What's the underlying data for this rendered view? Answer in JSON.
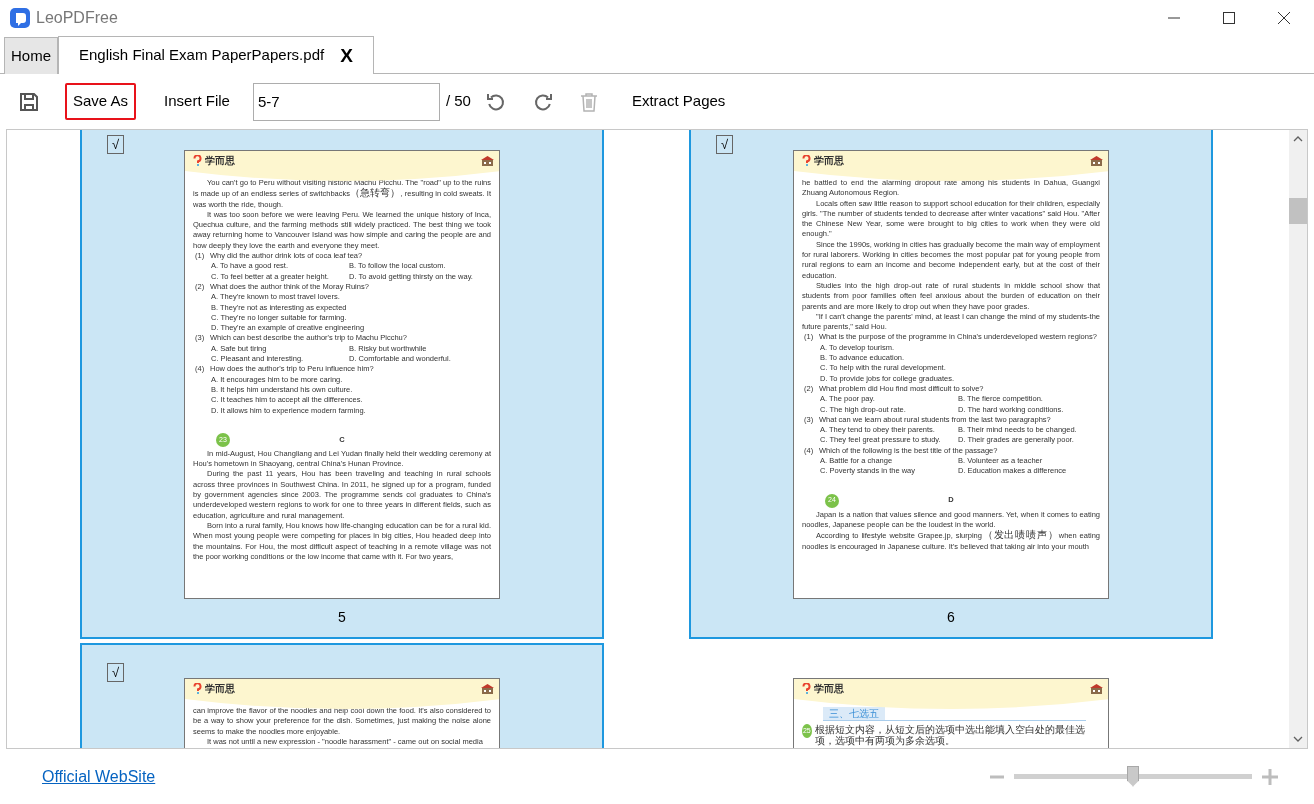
{
  "window": {
    "title": "LeoPDFree"
  },
  "tabs": [
    {
      "label": "Home",
      "selected": false
    },
    {
      "label": "English Final Exam PaperPapers.pdf",
      "selected": true,
      "close_label": "X"
    }
  ],
  "toolbar": {
    "save_as": {
      "label": "Save As",
      "highlighted": true
    },
    "insert_file": "Insert File",
    "page_range": {
      "value": "5-7"
    },
    "page_total": "/ 50",
    "delete": {
      "disabled": true
    },
    "extract_pages": "Extract Pages"
  },
  "check_glyph": "√",
  "pages": [
    {
      "number": "5",
      "selected": true,
      "logo": "学而思",
      "blocks": [
        {
          "kind": "para",
          "text": "You can't go to Peru without visiting historic Machu Picchu. The \"road\" up to the ruins is made up of an endless series of switchbacks（急转弯）, resulting in cold sweats. It was worth the ride, though."
        },
        {
          "kind": "para",
          "text": "It was too soon before we were leaving Peru. We learned the unique history of Inca, Quechua culture, and the farming methods still widely practiced. The best thing we took away returning home to Vancouver Island was how simple and caring the people are and how deeply they love the earth and everyone they meet."
        },
        {
          "kind": "question",
          "num": "(1)",
          "text": "Why did the author drink lots of coca leaf tea?"
        },
        {
          "kind": "pair",
          "a": "A. To have a good rest.",
          "b": "B. To follow the local custom."
        },
        {
          "kind": "pair",
          "a": "C. To feel better at a greater height.",
          "b": "D. To avoid getting thirsty on the way."
        },
        {
          "kind": "question",
          "num": "(2)",
          "text": "What does the author think of the Moray Ruins?"
        },
        {
          "kind": "option",
          "text": "A. They're known to most travel lovers."
        },
        {
          "kind": "option",
          "text": "B. They're not as interesting as expected"
        },
        {
          "kind": "option",
          "text": "C. They're no longer suitable for farming."
        },
        {
          "kind": "option",
          "text": "D. They're an example of creative engineering"
        },
        {
          "kind": "question",
          "num": "(3)",
          "text": "Which can best describe the author's trip to Machu Picchu?"
        },
        {
          "kind": "pair",
          "a": "A. Safe but tiring",
          "b": "B. Risky but worthwhile"
        },
        {
          "kind": "pair",
          "a": "C. Pleasant and interesting.",
          "b": "D. Comfortable and wonderful."
        },
        {
          "kind": "question",
          "num": "(4)",
          "text": "How does the author's trip to Peru influence him?"
        },
        {
          "kind": "option",
          "text": "A. It encourages him to be more caring."
        },
        {
          "kind": "option",
          "text": "B. It helps him understand his own culture."
        },
        {
          "kind": "option",
          "text": "C. It teaches him to accept all the differences."
        },
        {
          "kind": "option",
          "text": "D. It allows him to experience modern farming."
        },
        {
          "kind": "section",
          "badge": "23",
          "letter": "C"
        },
        {
          "kind": "para",
          "text": "In mid-August, Hou Changliang and Lei Yudan finally held their wedding ceremony at Hou's hometown in Shaoyang, central China's Hunan Province."
        },
        {
          "kind": "para",
          "text": "During the past 11 years, Hou has been traveling and teaching in rural schools across three provinces in Southwest China. In 2011, he signed up for a program, funded by government agencies since 2003. The programme sends col graduates to China's underdeveloped western regions to work for one to three years in different fields, such as education, agriculture and rural management."
        },
        {
          "kind": "para",
          "text": "Born into a rural family, Hou knows how life-changing education can be for a rural kid. When most young people were competing for places in big cities, Hou headed deep into the mountains. For Hou, the most difficult aspect of teaching in a remote village was not the poor working conditions or the low income that came with it. For two years,"
        }
      ]
    },
    {
      "number": "6",
      "selected": true,
      "logo": "学而思",
      "blocks": [
        {
          "kind": "cont",
          "text": "he battled to end the alarming dropout rate among his students in Dahua, Guangxi Zhuang Autonomous Region."
        },
        {
          "kind": "para",
          "text": "Locals often saw little reason to support school education for their children, especially girls. \"The number of students tended to decrease after winter vacations\" said Hou. \"After the Chinese New Year, some were brought to big cities to work when they were old enough.\""
        },
        {
          "kind": "para",
          "text": "Since the 1990s, working in cities has gradually become the main way of employment for rural laborers. Working in cities becomes the most popular pat for young people from rural regions to earn an income and become independent early, but at the cost of their education."
        },
        {
          "kind": "para",
          "text": "Studies into the high drop-out rate of rural students in middle school show that students from poor families often feel anxious about the burden of education on their parents and are more likely to drop out when they have poor grades."
        },
        {
          "kind": "para",
          "text": "\"If I can't change the parents' mind, at least I can change the mind of my students-the future parents,\" said Hou."
        },
        {
          "kind": "question",
          "num": "(1)",
          "text": "What is the purpose of the programme in China's underdeveloped western regions?"
        },
        {
          "kind": "option",
          "text": "A. To develop tourism."
        },
        {
          "kind": "option",
          "text": "B. To advance education."
        },
        {
          "kind": "option",
          "text": "C. To help with the rural development."
        },
        {
          "kind": "option",
          "text": "D. To provide jobs for college graduates."
        },
        {
          "kind": "question",
          "num": "(2)",
          "text": "What problem did Hou find most difficult to solve?"
        },
        {
          "kind": "pair",
          "a": "A. The poor pay.",
          "b": "B. The fierce competition."
        },
        {
          "kind": "pair",
          "a": "C. The high drop-out rate.",
          "b": "D. The hard working conditions."
        },
        {
          "kind": "question",
          "num": "(3)",
          "text": "What can we learn about rural students from the last two paragraphs?"
        },
        {
          "kind": "pair",
          "a": "A. They tend to obey their parents.",
          "b": "B. Their mind needs to be changed."
        },
        {
          "kind": "pair",
          "a": "C. They feel great pressure to study.",
          "b": "D. Their grades are generally poor."
        },
        {
          "kind": "question",
          "num": "(4)",
          "text": "Which of the following is the best title of the passage?"
        },
        {
          "kind": "pair",
          "a": "A. Battle for a change",
          "b": "B. Volunteer as a teacher"
        },
        {
          "kind": "pair",
          "a": "C. Poverty stands in the way",
          "b": "D. Education makes a difference"
        },
        {
          "kind": "section",
          "badge": "24",
          "letter": "D"
        },
        {
          "kind": "para",
          "text": "Japan is a nation that values silence and good manners. Yet, when it comes to eating noodles, Japanese people can be the loudest in the world."
        },
        {
          "kind": "para",
          "text": "According to lifestyle website Grapee.jp, slurping（发出啧啧声）when eating noodles is encouraged in Japanese culture. It's believed that taking air into your mouth"
        }
      ]
    },
    {
      "selected": true,
      "logo": "学而思",
      "blocks": [
        {
          "kind": "cont",
          "text": "can improve the flavor of the noodles and help cool down the food. It's also considered to be a way to show your preference for the dish. Sometimes, just making the noise alone seems to make the noodles more enjoyable."
        },
        {
          "kind": "para",
          "text": "It was not until a new expression - \"noodle harassment\" - came out on social media"
        }
      ]
    },
    {
      "selected": false,
      "logo": "学而思",
      "blocks": [
        {
          "kind": "title",
          "text": "三、七选五"
        },
        {
          "kind": "instruction",
          "badge": "25",
          "text": "根据短文内容，从短文后的选项中选出能填入空白处的最佳选项，选项中有两项为多余选项。"
        }
      ]
    }
  ],
  "footer": {
    "link": "Official WebSite",
    "zoom": {
      "level": 0.5
    }
  }
}
